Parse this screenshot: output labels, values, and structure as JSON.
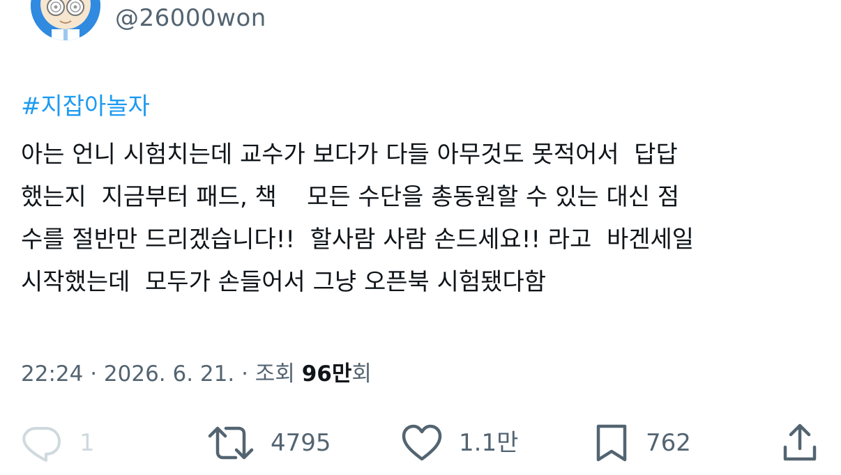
{
  "author": {
    "handle": "@26000won"
  },
  "tweet": {
    "hashtag": "#지잡아놀자",
    "lines": [
      "아는 언니 시험치는데 교수가 보다가 다들 아무것도 못적어서  답답",
      "했는지  지금부터 패드, 책    모든 수단을 총동원할 수 있는 대신 점",
      "수를 절반만 드리겠습니다!!  할사람 사람 손드세요!! 라고  바겐세일",
      "시작했는데  모두가 손들어서 그냥 오픈북 시험됐다함"
    ]
  },
  "meta": {
    "time_date": "22:24 · 2026. 6. 21. · 조회 ",
    "views_count": "96만",
    "views_suffix": "회"
  },
  "actions": {
    "reply": {
      "icon": "reply-icon",
      "count": "1"
    },
    "retweet": {
      "icon": "retweet-icon",
      "count": "4795"
    },
    "like": {
      "icon": "heart-icon",
      "count": "1.1만"
    },
    "bookmark": {
      "icon": "bookmark-icon",
      "count": "762"
    },
    "share": {
      "icon": "share-icon"
    }
  },
  "colors": {
    "text": "#0f1419",
    "secondary": "#536471",
    "link": "#1d9bf0",
    "disabled": "#cfd9de",
    "avatar_bg": "#2f8ae0"
  }
}
